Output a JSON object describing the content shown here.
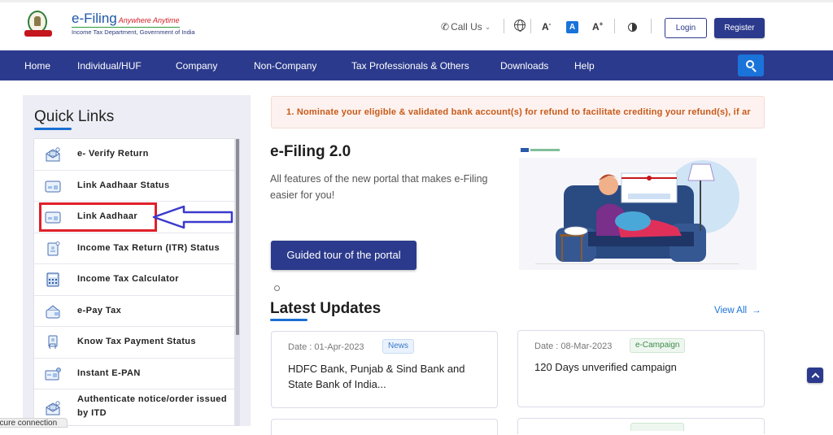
{
  "header": {
    "logo": {
      "title": "e-Filing",
      "tagline": "Anywhere Anytime",
      "subtitle": "Income Tax Department, Government of India"
    },
    "utilities": {
      "call_us": "Call Us",
      "font_decrease": "A",
      "font_default": "A",
      "font_increase": "A",
      "font_decrease_sup": "-",
      "font_increase_sup": "+"
    },
    "login_label": "Login",
    "register_label": "Register"
  },
  "nav": {
    "items": [
      {
        "label": "Home"
      },
      {
        "label": "Individual/HUF"
      },
      {
        "label": "Company"
      },
      {
        "label": "Non-Company"
      },
      {
        "label": "Tax Professionals & Others"
      },
      {
        "label": "Downloads"
      },
      {
        "label": "Help"
      }
    ]
  },
  "quick_links": {
    "title": "Quick Links",
    "items": [
      {
        "label": "e- Verify Return",
        "icon": "envelope-verify-icon"
      },
      {
        "label": "Link Aadhaar Status",
        "icon": "aadhaar-card-icon"
      },
      {
        "label": "Link Aadhaar",
        "icon": "aadhaar-card-icon"
      },
      {
        "label": "Income Tax Return (ITR) Status",
        "icon": "document-status-icon"
      },
      {
        "label": "Income Tax Calculator",
        "icon": "calculator-icon"
      },
      {
        "label": "e-Pay Tax",
        "icon": "wallet-card-icon"
      },
      {
        "label": "Know Tax Payment Status",
        "icon": "payment-receipt-icon"
      },
      {
        "label": "Instant E-PAN",
        "icon": "pan-card-icon"
      },
      {
        "label": "Authenticate notice/order issued by ITD",
        "icon": "envelope-verify-icon"
      }
    ],
    "highlighted_item": "Link Aadhaar"
  },
  "ticker": {
    "text": "1. Nominate your eligible & validated bank account(s) for refund to facilitate crediting your refund(s), if ar"
  },
  "hero": {
    "title": "e-Filing 2.0",
    "description": "All  features of the new portal that makes e-Filing easier for you!",
    "button_label": "Guided tour of the portal"
  },
  "latest_updates": {
    "title": "Latest Updates",
    "view_all_label": "View All",
    "cards": [
      {
        "date": "Date : 01-Apr-2023",
        "badge": "News",
        "text": "HDFC Bank, Punjab & Sind Bank and State Bank of India..."
      },
      {
        "date": "Date : 08-Mar-2023",
        "badge": "e-Campaign",
        "text": "120 Days unverified campaign"
      }
    ]
  },
  "colors": {
    "brand_navy": "#2b3a8c",
    "accent_blue": "#1a73d9",
    "ticker_text": "#c75a1a",
    "highlight_red": "#e0202a",
    "arrow_blue": "#3a3acc"
  },
  "statusbar": {
    "text": "ecure connection"
  }
}
